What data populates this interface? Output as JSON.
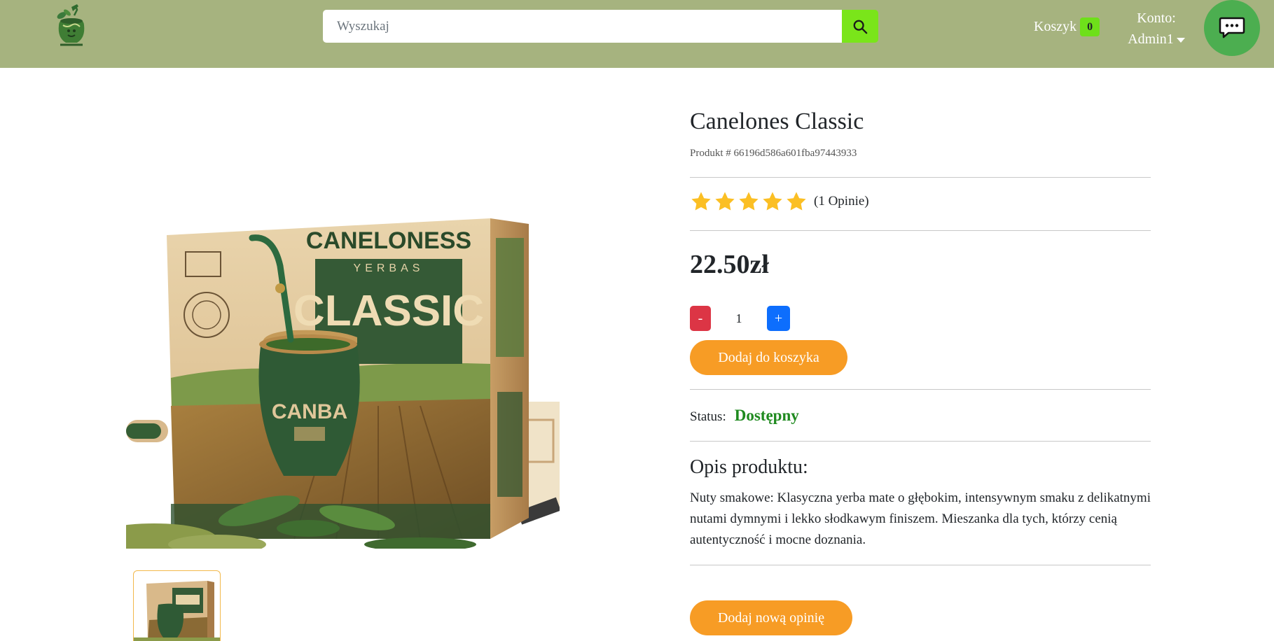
{
  "header": {
    "search_placeholder": "Wyszukaj",
    "cart_label": "Koszyk",
    "cart_count": "0",
    "account_label": "Konto:",
    "account_user": "Admin1"
  },
  "product": {
    "title": "Canelones Classic",
    "id_label": "Produkt # 66196d586a601fba97443933",
    "rating": 5,
    "reviews_count": "(1 Opinie)",
    "price": "22.50zł",
    "qty_minus": "-",
    "qty_value": "1",
    "qty_plus": "+",
    "add_to_cart": "Dodaj do koszyka",
    "status_label": "Status:",
    "status_value": "Dostępny",
    "description_heading": "Opis produktu:",
    "description": "Nuty smakowe: Klasyczna yerba mate o głębokim, intensywnym smaku z delikatnymi nutami dymnymi i lekko słodkawym finiszem. Mieszanka dla tych, którzy cenią autentyczność i mocne doznania.",
    "add_review": "Dodaj nową opinię"
  },
  "image_text": {
    "brand_top": "CANELONESS",
    "brand_sub": "YERBAS",
    "brand_main": "CLASSIC",
    "gourd_text": "CANBA"
  },
  "colors": {
    "header_bg": "#a6b37f",
    "search_btn": "#7ae51a",
    "chat_btn": "#4cae50",
    "star": "#fbbf24",
    "orange_btn": "#f79c25",
    "status_green": "#1f8a1f",
    "minus_btn": "#dc3545",
    "plus_btn": "#0d6efd"
  },
  "icons": [
    "mate-logo-icon",
    "search-icon",
    "caret-down-icon",
    "chat-icon",
    "star-icon"
  ]
}
